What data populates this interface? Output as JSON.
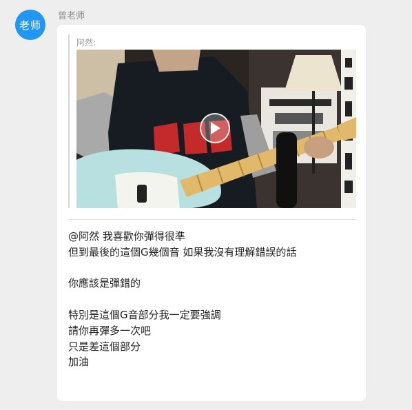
{
  "sender": {
    "avatar_text": "老师",
    "name": "曾老师",
    "avatar_color": "#2196f3"
  },
  "quote": {
    "author": "阿然:",
    "video_icon": "play-icon"
  },
  "message": {
    "lines": [
      "@阿然 我喜歡你彈得很準",
      "但到最後的這個G幾個音 如果我沒有理解錯誤的話",
      "",
      "你應該是彈錯的",
      "",
      "特別是這個G音部分我一定要強調",
      "請你再彈多一次吧",
      "只是差這個部分",
      "加油"
    ]
  },
  "colors": {
    "background": "#eeeeee",
    "bubble": "#ffffff",
    "guitar_body": "#b9e0e0"
  }
}
